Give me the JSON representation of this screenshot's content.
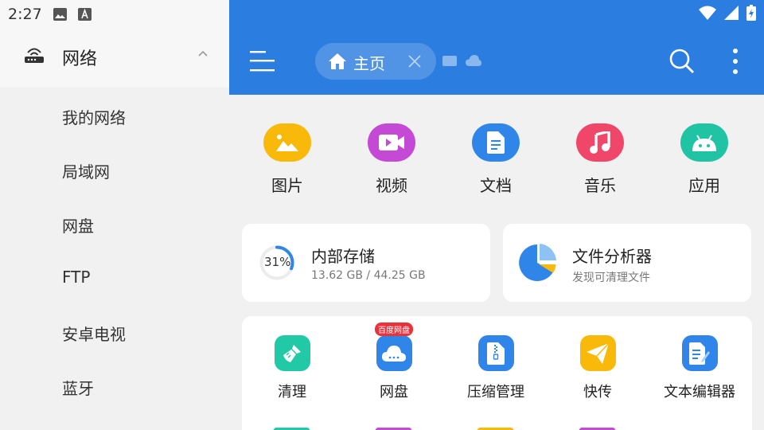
{
  "status": {
    "time": "2:27"
  },
  "drawer": {
    "section_label": "网络",
    "items": [
      "我的网络",
      "局域网",
      "网盘",
      "FTP",
      "安卓电视",
      "蓝牙"
    ]
  },
  "tab": {
    "label": "主页"
  },
  "categories": [
    {
      "label": "图片",
      "icon": "image-icon",
      "color": "#f9b90a"
    },
    {
      "label": "视频",
      "icon": "video-icon",
      "color": "#c44ad6"
    },
    {
      "label": "文档",
      "icon": "document-icon",
      "color": "#2f86e8"
    },
    {
      "label": "音乐",
      "icon": "music-icon",
      "color": "#f0466a"
    },
    {
      "label": "应用",
      "icon": "android-icon",
      "color": "#20c4a4"
    }
  ],
  "storage": {
    "percent_label": "31%",
    "percent": 31,
    "title": "内部存储",
    "detail": "13.62 GB / 44.25 GB"
  },
  "analyzer": {
    "title": "文件分析器",
    "subtitle": "发现可清理文件"
  },
  "tools": [
    {
      "label": "清理",
      "icon": "broom-icon",
      "color": "#22c9a6"
    },
    {
      "label": "网盘",
      "icon": "cloud-icon",
      "color": "#2f86e8",
      "badge": "百度网盘"
    },
    {
      "label": "压缩管理",
      "icon": "zip-icon",
      "color": "#2f86e8"
    },
    {
      "label": "快传",
      "icon": "send-icon",
      "color": "#f9b90a"
    },
    {
      "label": "文本编辑器",
      "icon": "text-editor-icon",
      "color": "#2f86e8"
    }
  ],
  "colors": {
    "accent": "#2b7de0"
  }
}
